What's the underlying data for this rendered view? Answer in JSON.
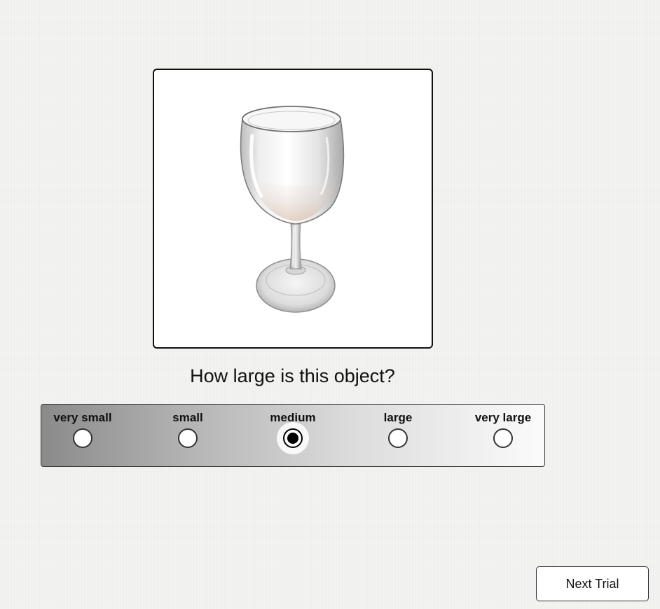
{
  "stimulus": {
    "image_subject": "wine-glass"
  },
  "question": {
    "text": "How large is this object?"
  },
  "scale": {
    "selected_index": 2,
    "options": [
      {
        "label": "very small"
      },
      {
        "label": "small"
      },
      {
        "label": "medium"
      },
      {
        "label": "large"
      },
      {
        "label": "very large"
      }
    ]
  },
  "navigation": {
    "next_label": "Next Trial"
  },
  "colors": {
    "page_background": "#f1f1ef",
    "frame_border": "#111111",
    "selected_radio": "#000000"
  }
}
